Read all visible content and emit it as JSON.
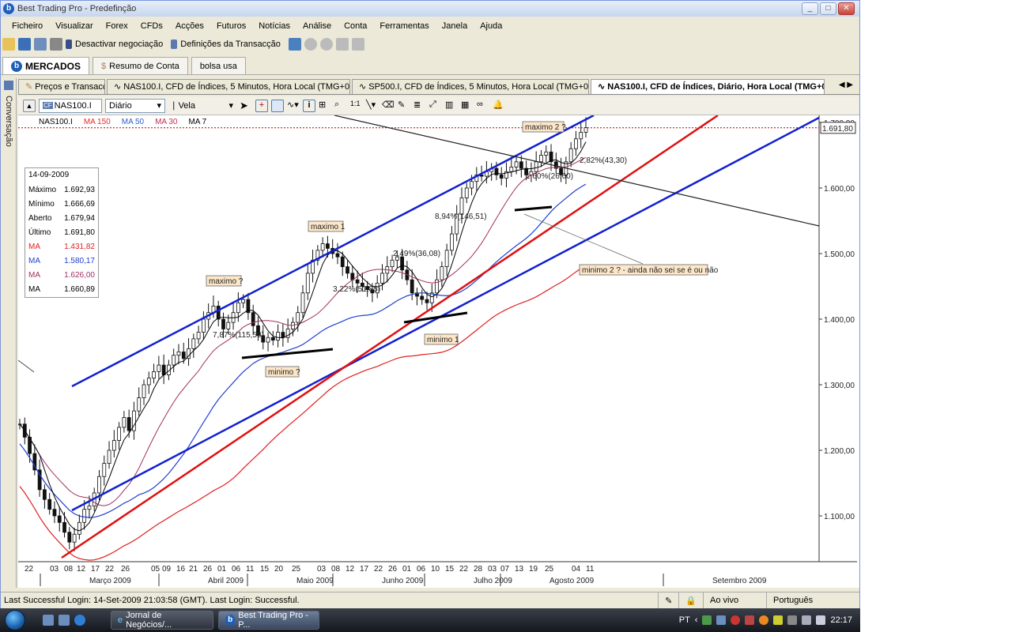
{
  "window": {
    "title": "Best Trading Pro - Predefinção",
    "min": "_",
    "max": "□",
    "close": "✕"
  },
  "menu": [
    "Ficheiro",
    "Visualizar",
    "Forex",
    "CFDs",
    "Acções",
    "Futuros",
    "Notícias",
    "Análise",
    "Conta",
    "Ferramentas",
    "Janela",
    "Ajuda"
  ],
  "toolbar": {
    "deactivate": "Desactivar negociação",
    "settings": "Definições da Transacção"
  },
  "navtabs": [
    "MERCADOS",
    "Resumo de Conta",
    "bolsa usa"
  ],
  "sidebar": {
    "label": "Conversação"
  },
  "charttabs": [
    "Preços e Transacção",
    "NAS100.I, CFD de Índices, 5 Minutos, Hora Local (TMG+0)",
    "SP500.I, CFD de Índices, 5 Minutos, Hora Local (TMG+0)",
    "NAS100.I, CFD de Índices, Diário, Hora Local (TMG+0)"
  ],
  "charttool": {
    "symbol": "NAS100.I",
    "period": "Diário",
    "style": "Vela"
  },
  "indicators": [
    "NAS100.I",
    "MA 150",
    "MA 50",
    "MA 30",
    "MA 7"
  ],
  "indicator_colors": [
    "#555555",
    "#e03030",
    "#3060d0",
    "#c03050",
    "#333333"
  ],
  "infobox": {
    "date": "14-09-2009",
    "rows": [
      {
        "label": "Máximo",
        "value": "1.692,93",
        "color": "#000000"
      },
      {
        "label": "Mínimo",
        "value": "1.666,69",
        "color": "#000000"
      },
      {
        "label": "Aberto",
        "value": "1.679,94",
        "color": "#000000"
      },
      {
        "label": "Último",
        "value": "1.691,80",
        "color": "#000000"
      },
      {
        "label": "MA",
        "value": "1.431,82",
        "color": "#e02020"
      },
      {
        "label": "MA",
        "value": "1.580,17",
        "color": "#2040d0"
      },
      {
        "label": "MA",
        "value": "1.626,00",
        "color": "#a03060"
      },
      {
        "label": "MA",
        "value": "1.660,89",
        "color": "#000000"
      }
    ]
  },
  "y_axis": {
    "labels": [
      "1.700,00",
      "1.600,00",
      "1.500,00",
      "1.400,00",
      "1.300,00",
      "1.200,00",
      "1.100,00"
    ],
    "current": "1.691,80"
  },
  "x_axis": {
    "days": [
      "22",
      "03",
      "08",
      "12",
      "17",
      "22",
      "26",
      "05",
      "09",
      "16",
      "21",
      "26",
      "01",
      "06",
      "11",
      "15",
      "20",
      "25",
      "03",
      "08",
      "12",
      "17",
      "22",
      "26",
      "01",
      "06",
      "10",
      "15",
      "22",
      "28",
      "03",
      "07",
      "13",
      "19",
      "25",
      "04",
      "11"
    ],
    "months": [
      "Março 2009",
      "Abril 2009",
      "Maio 2009",
      "Junho 2009",
      "Julho 2009",
      "Agosto 2009",
      "Setembro 2009"
    ]
  },
  "annotations": {
    "maximo": "maximo ?",
    "maximo1": "maximo 1",
    "maximo2": "maximo 2 ?",
    "minimo": "minimo ?",
    "minimo1": "minimo 1",
    "minimo2": "minimo 2 ? - ainda não sei se é ou não",
    "p1": "7,87%(115,50)",
    "p2": "3,22%(51,85)",
    "p3": "2,49%(36,08)",
    "p4": "8,94%(146,51)",
    "p5": "1,60%(26,60)",
    "p6": "2,82%(43,30)"
  },
  "status": {
    "message": "Last Successful Login: 14-Set-2009 21:03:58 (GMT). Last Login: Successful.",
    "live": "Ao vivo",
    "language": "Português"
  },
  "taskbar": {
    "items": [
      "Jornal de Negócios/...",
      "Best Trading Pro - P..."
    ],
    "lang": "PT",
    "time": "22:17"
  }
}
